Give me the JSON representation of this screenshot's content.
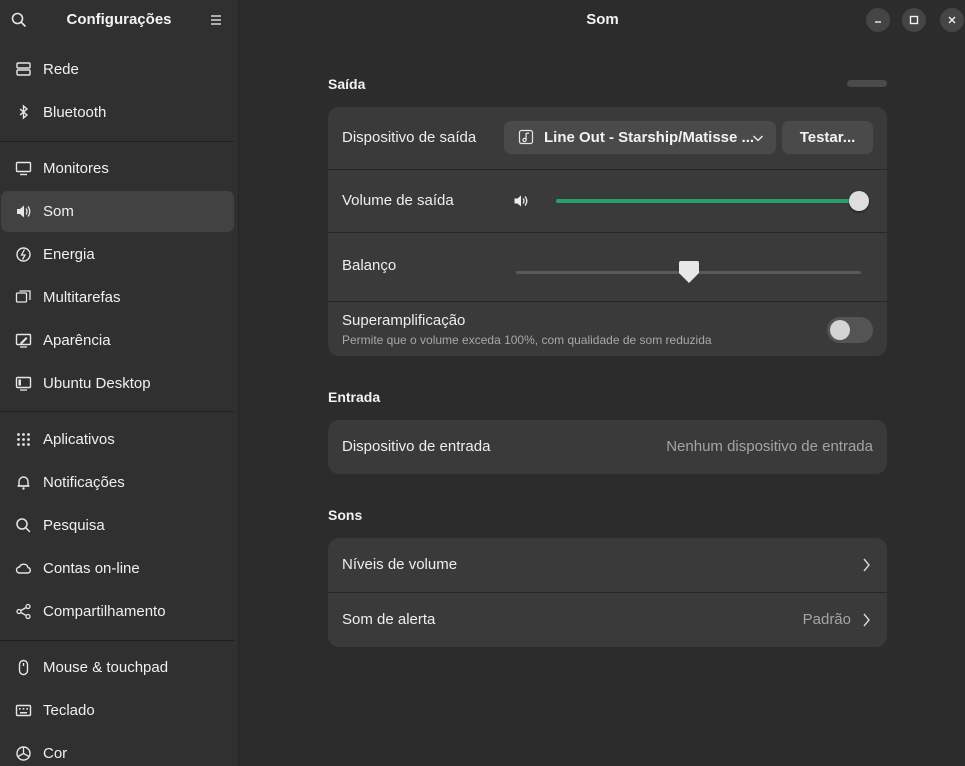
{
  "sidebar": {
    "title": "Configurações",
    "items": [
      {
        "label": "Rede",
        "icon": "network-icon"
      },
      {
        "label": "Bluetooth",
        "icon": "bluetooth-icon"
      },
      {
        "label": "Monitores",
        "icon": "monitor-icon"
      },
      {
        "label": "Som",
        "icon": "speaker-icon",
        "active": true
      },
      {
        "label": "Energia",
        "icon": "power-icon"
      },
      {
        "label": "Multitarefas",
        "icon": "multitasking-icon"
      },
      {
        "label": "Aparência",
        "icon": "appearance-icon"
      },
      {
        "label": "Ubuntu Desktop",
        "icon": "desktop-icon"
      },
      {
        "label": "Aplicativos",
        "icon": "apps-grid-icon"
      },
      {
        "label": "Notificações",
        "icon": "bell-icon"
      },
      {
        "label": "Pesquisa",
        "icon": "search-icon"
      },
      {
        "label": "Contas on-line",
        "icon": "cloud-icon"
      },
      {
        "label": "Compartilhamento",
        "icon": "share-icon"
      },
      {
        "label": "Mouse & touchpad",
        "icon": "mouse-icon"
      },
      {
        "label": "Teclado",
        "icon": "keyboard-icon"
      },
      {
        "label": "Cor",
        "icon": "color-icon"
      }
    ]
  },
  "main": {
    "title": "Som",
    "output": {
      "section_title": "Saída",
      "device_label": "Dispositivo de saída",
      "device_value": "Line Out - Starship/Matisse ...",
      "test_button": "Testar...",
      "volume_label": "Volume de saída",
      "volume_level": 1.0,
      "balance_label": "Balanço",
      "balance_level": 0.5,
      "overamp_label": "Superamplificação",
      "overamp_sub": "Permite que o volume exceda 100%, com qualidade de som reduzida",
      "overamp_on": false
    },
    "input": {
      "section_title": "Entrada",
      "device_label": "Dispositivo de entrada",
      "device_value": "Nenhum dispositivo de entrada"
    },
    "sounds": {
      "section_title": "Sons",
      "volume_levels_label": "Níveis de volume",
      "alert_label": "Som de alerta",
      "alert_value": "Padrão"
    }
  },
  "colors": {
    "accent": "#26a269",
    "sidebar_bg": "#303030",
    "main_bg": "#2c2c2c",
    "card_bg": "#3a3a3a"
  }
}
